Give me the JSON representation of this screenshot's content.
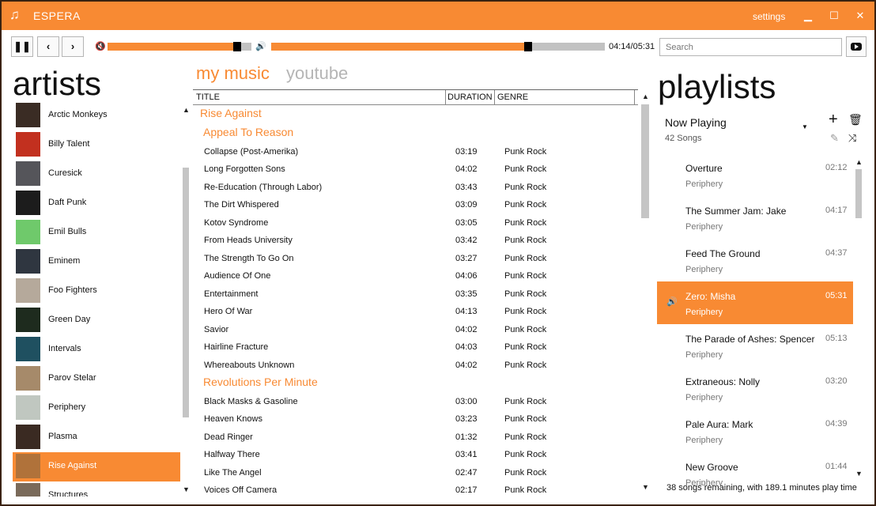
{
  "app": {
    "title": "ESPERA",
    "settings_label": "settings",
    "icon": "music-note-icon",
    "accent_color": "#f88a33"
  },
  "player": {
    "time": "04:14/05:31",
    "volume_level": 0.9,
    "progress": 0.77,
    "search_placeholder": "Search",
    "buttons": [
      "pause-icon",
      "previous-icon",
      "next-icon"
    ]
  },
  "artists": {
    "title": "artists",
    "items": [
      {
        "name": "Arctic Monkeys",
        "thumb": "#3a2c24"
      },
      {
        "name": "Billy Talent",
        "thumb": "#c2301f"
      },
      {
        "name": "Curesick",
        "thumb": "#55555a"
      },
      {
        "name": "Daft Punk",
        "thumb": "#1c1c1c"
      },
      {
        "name": "Emil Bulls",
        "thumb": "#6fc96b"
      },
      {
        "name": "Eminem",
        "thumb": "#2f3640"
      },
      {
        "name": "Foo Fighters",
        "thumb": "#b5a99b"
      },
      {
        "name": "Green Day",
        "thumb": "#1e2b1e"
      },
      {
        "name": "Intervals",
        "thumb": "#1f5060"
      },
      {
        "name": "Parov Stelar",
        "thumb": "#a68a6a"
      },
      {
        "name": "Periphery",
        "thumb": "#c0c7c0"
      },
      {
        "name": "Plasma",
        "thumb": "#3a2a22"
      },
      {
        "name": "Rise Against",
        "thumb": "#b0723a",
        "selected": true
      },
      {
        "name": "Structures",
        "thumb": "#7a6a5a"
      }
    ]
  },
  "tabs": {
    "my_music": "my music",
    "youtube": "youtube"
  },
  "table": {
    "headers": {
      "title": "TITLE",
      "duration": "DURATION",
      "genre": "GENRE"
    },
    "artist_group": "Rise Against",
    "albums": [
      {
        "name": "Appeal To Reason",
        "songs": [
          {
            "title": "Collapse (Post-Amerika)",
            "duration": "03:19",
            "genre": "Punk Rock"
          },
          {
            "title": "Long Forgotten Sons",
            "duration": "04:02",
            "genre": "Punk Rock"
          },
          {
            "title": "Re-Education (Through Labor)",
            "duration": "03:43",
            "genre": "Punk Rock"
          },
          {
            "title": "The Dirt Whispered",
            "duration": "03:09",
            "genre": "Punk Rock"
          },
          {
            "title": "Kotov Syndrome",
            "duration": "03:05",
            "genre": "Punk Rock"
          },
          {
            "title": "From Heads University",
            "duration": "03:42",
            "genre": "Punk Rock"
          },
          {
            "title": "The Strength To Go On",
            "duration": "03:27",
            "genre": "Punk Rock"
          },
          {
            "title": "Audience Of One",
            "duration": "04:06",
            "genre": "Punk Rock"
          },
          {
            "title": "Entertainment",
            "duration": "03:35",
            "genre": "Punk Rock"
          },
          {
            "title": "Hero Of War",
            "duration": "04:13",
            "genre": "Punk Rock"
          },
          {
            "title": "Savior",
            "duration": "04:02",
            "genre": "Punk Rock"
          },
          {
            "title": "Hairline Fracture",
            "duration": "04:03",
            "genre": "Punk Rock"
          },
          {
            "title": "Whereabouts Unknown",
            "duration": "04:02",
            "genre": "Punk Rock"
          }
        ]
      },
      {
        "name": "Revolutions Per Minute",
        "songs": [
          {
            "title": "Black Masks & Gasoline",
            "duration": "03:00",
            "genre": "Punk Rock"
          },
          {
            "title": "Heaven Knows",
            "duration": "03:23",
            "genre": "Punk Rock"
          },
          {
            "title": "Dead Ringer",
            "duration": "01:32",
            "genre": "Punk Rock"
          },
          {
            "title": "Halfway There",
            "duration": "03:41",
            "genre": "Punk Rock"
          },
          {
            "title": "Like The Angel",
            "duration": "02:47",
            "genre": "Punk Rock"
          },
          {
            "title": "Voices Off Camera",
            "duration": "02:17",
            "genre": "Punk Rock"
          }
        ]
      }
    ]
  },
  "playlists": {
    "title": "playlists",
    "current_name": "Now Playing",
    "song_count": "42 Songs",
    "items": [
      {
        "title": "Overture",
        "artist": "Periphery",
        "duration": "02:12"
      },
      {
        "title": "The Summer Jam: Jake",
        "artist": "Periphery",
        "duration": "04:17"
      },
      {
        "title": "Feed The Ground",
        "artist": "Periphery",
        "duration": "04:37"
      },
      {
        "title": "Zero: Misha",
        "artist": "Periphery",
        "duration": "05:31",
        "playing": true
      },
      {
        "title": "The Parade of Ashes: Spencer",
        "artist": "Periphery",
        "duration": "05:13"
      },
      {
        "title": "Extraneous: Nolly",
        "artist": "Periphery",
        "duration": "03:20"
      },
      {
        "title": "Pale Aura: Mark",
        "artist": "Periphery",
        "duration": "04:39"
      },
      {
        "title": "New Groove",
        "artist": "Periphery",
        "duration": "01:44"
      }
    ],
    "remaining": "38 songs remaining, with 189.1 minutes play time"
  }
}
